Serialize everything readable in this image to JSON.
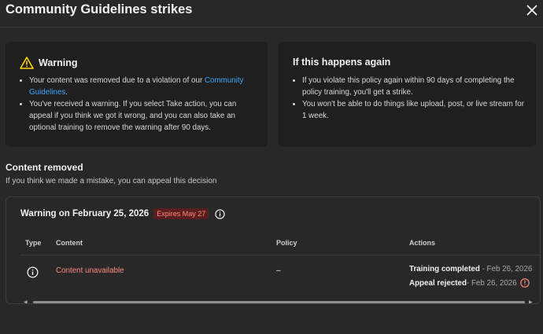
{
  "dialog": {
    "title": "Community Guidelines strikes",
    "close_icon": "close-icon"
  },
  "warning_card": {
    "icon": "warning-triangle-icon",
    "heading": "Warning",
    "bullet1_pre": "Your content was removed due to a violation of our ",
    "bullet1_link": "Community Guidelines",
    "bullet1_post": ".",
    "bullet2": "You've received a warning. If you select Take action, you can appeal if you think we got it wrong, and you can also take an optional training to remove the warning after 90 days."
  },
  "again_card": {
    "heading": "If this happens again",
    "bullet1": "If you violate this policy again within 90 days of completing the policy training, you'll get a strike.",
    "bullet2": "You won't be able to do things like upload, post, or live stream for 1 week."
  },
  "content_removed": {
    "title": "Content removed",
    "subtitle": "If you think we made a mistake, you can appeal this decision"
  },
  "strike": {
    "title": "Warning on February 25, 2026",
    "badge": "Expires May 27",
    "info_icon": "info-icon",
    "columns": [
      "Type",
      "Content",
      "Policy",
      "Actions"
    ],
    "row": {
      "type_icon": "info-icon",
      "content": "Content unavailable",
      "policy": "–",
      "action1_label": "Training completed",
      "action1_date": " - Feb 26, 2026",
      "action2_label": "Appeal rejected",
      "action2_date": " - Feb 26, 2026",
      "action2_icon": "error-icon"
    }
  },
  "colors": {
    "background": "#282828",
    "card": "#1f1f1f",
    "link": "#3ea6ff",
    "error": "#ff8a80",
    "warning": "#ffd600"
  }
}
